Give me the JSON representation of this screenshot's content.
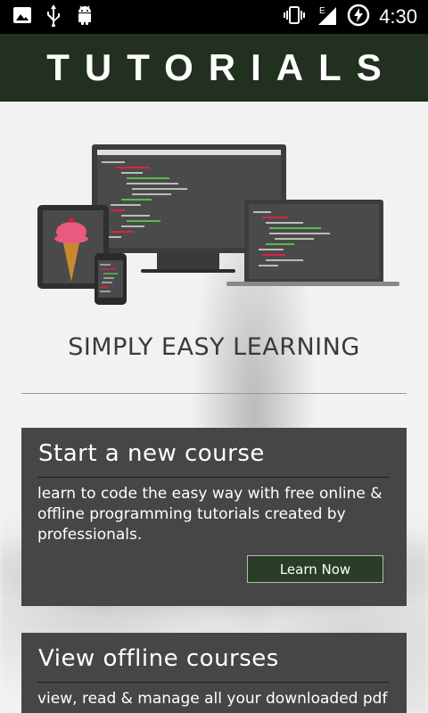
{
  "status_bar": {
    "time": "4:30",
    "icons": [
      "image-icon",
      "usb-icon",
      "android-icon",
      "vibrate-icon",
      "signal-e-icon",
      "battery-charging-icon"
    ]
  },
  "header": {
    "title": "TUTORIALS"
  },
  "tagline": "SIMPLY EASY LEARNING",
  "cards": [
    {
      "title": "Start a new course",
      "text": "learn to code the easy way with free online & offline programming tutorials created by professionals.",
      "button": "Learn Now"
    },
    {
      "title": "View offline courses",
      "text": "view, read & manage all your downloaded pdf"
    }
  ],
  "colors": {
    "header_bg": "#22311f",
    "card_bg": "#464646",
    "button_bg": "#2a3d27"
  }
}
